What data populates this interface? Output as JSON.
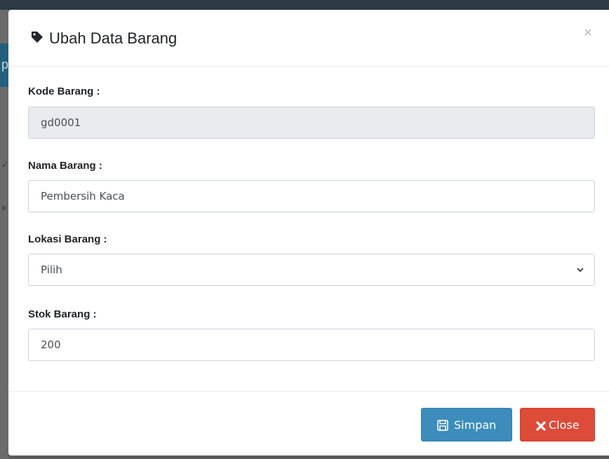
{
  "background": {
    "header_letter": "p"
  },
  "modal": {
    "title": "Ubah Data Barang",
    "title_icon": "tag-icon",
    "close_symbol": "×"
  },
  "form": {
    "kode": {
      "label": "Kode Barang :",
      "value": "gd0001",
      "readonly": true
    },
    "nama": {
      "label": "Nama Barang :",
      "value": "Pembersih Kaca"
    },
    "lokasi": {
      "label": "Lokasi Barang :",
      "selected": "Pilih"
    },
    "stok": {
      "label": "Stok Barang :",
      "value": "200"
    }
  },
  "footer": {
    "save_label": "Simpan",
    "save_icon": "floppy-disk-icon",
    "close_label": "Close",
    "close_icon": "x-icon"
  },
  "colors": {
    "primary": "#3c8dbc",
    "danger": "#dd4b39",
    "readonly_bg": "#e9ecef"
  }
}
